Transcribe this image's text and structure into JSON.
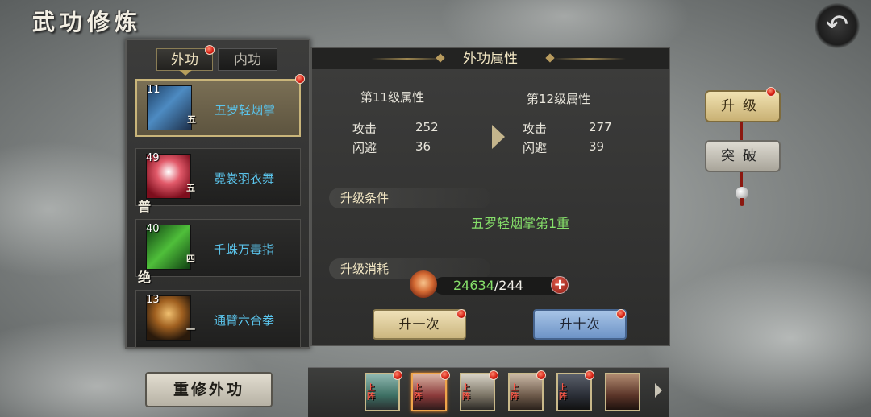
{
  "screen_title": "武功修炼",
  "tabs": [
    {
      "label": "外功",
      "active": true,
      "has_dot": true
    },
    {
      "label": "内功",
      "active": false,
      "has_dot": false
    }
  ],
  "skills": [
    {
      "level": "11",
      "grade": "五",
      "tag": "",
      "name": "五罗轻烟掌",
      "selected": true
    },
    {
      "level": "49",
      "grade": "五",
      "tag": "普",
      "name": "霓裳羽衣舞",
      "selected": false
    },
    {
      "level": "40",
      "grade": "四",
      "tag": "绝",
      "name": "千蛛万毒指",
      "selected": false
    },
    {
      "level": "13",
      "grade": "一",
      "tag": "",
      "name": "通臂六合拳",
      "selected": false
    }
  ],
  "panel": {
    "header": "外功属性",
    "current": {
      "title": "第11级属性",
      "stats": [
        {
          "label": "攻击",
          "value": "252"
        },
        {
          "label": "闪避",
          "value": "36"
        }
      ]
    },
    "next": {
      "title": "第12级属性",
      "stats": [
        {
          "label": "攻击",
          "value": "277"
        },
        {
          "label": "闪避",
          "value": "39"
        }
      ]
    },
    "condition_label": "升级条件",
    "condition_value": "五罗轻烟掌第1重",
    "cost_label": "升级消耗",
    "cost_have": "24634",
    "cost_need": "/244",
    "plus": "+",
    "btn_once": "升一次",
    "btn_ten": "升十次"
  },
  "side": {
    "upgrade": "升级",
    "breakthrough": "突破"
  },
  "reset_button": "重修外功",
  "portraits": [
    {
      "tag1": "上",
      "tag2": "阵",
      "color": "#3d6f63",
      "selected": false
    },
    {
      "tag1": "上",
      "tag2": "阵",
      "color": "#8b3a3a",
      "selected": true
    },
    {
      "tag1": "上",
      "tag2": "阵",
      "color": "#7b7465",
      "selected": false
    },
    {
      "tag1": "上",
      "tag2": "阵",
      "color": "#6d5a4a",
      "selected": false
    },
    {
      "tag1": "上",
      "tag2": "阵",
      "color": "#2a2e36",
      "selected": false
    },
    {
      "tag1": "",
      "tag2": "",
      "color": "#5a3428",
      "selected": false
    }
  ],
  "colors": {
    "accent_gold": "#c9b57a",
    "skill_name": "#5ac3ea",
    "condition_green": "#86e06a",
    "red_dot": "#d21b0f"
  },
  "icons": {
    "back": "back-arrow-icon",
    "arrow": "chevron-right-icon"
  }
}
